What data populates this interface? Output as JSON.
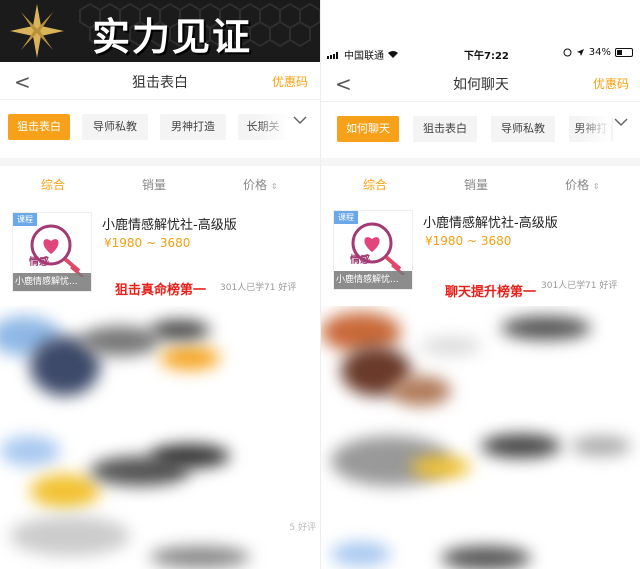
{
  "banner": {
    "title": "实力见证"
  },
  "status": {
    "carrier": "中国联通",
    "time": "下午7:22",
    "battery": "34%"
  },
  "left": {
    "nav": {
      "back": "<",
      "title": "狙击表白",
      "coupon": "优惠码"
    },
    "tabs": [
      "狙击表白",
      "导师私教",
      "男神打造",
      "长期关"
    ],
    "sort": {
      "a": "综合",
      "b": "销量",
      "c": "价格"
    },
    "course": {
      "badge": "课程",
      "title": "小鹿情感解忧社-高级版",
      "price": "¥1980 ~ 3680",
      "learned": "301人已学",
      "rating": "71 好评",
      "thumb_label": "情感",
      "thumb_caption": "小鹿情感解忧..."
    },
    "overlay": "狙击真命榜第一",
    "tail": "5 好评"
  },
  "right": {
    "nav": {
      "back": "<",
      "title": "如何聊天",
      "coupon": "优惠码"
    },
    "tabs": [
      "如何聊天",
      "狙击表白",
      "导师私教",
      "男神打"
    ],
    "sort": {
      "a": "综合",
      "b": "销量",
      "c": "价格"
    },
    "course": {
      "badge": "课程",
      "title": "小鹿情感解忧社-高级版",
      "price": "¥1980 ~ 3680",
      "learned": "301人已学",
      "rating": "71 好评",
      "thumb_label": "情感",
      "thumb_caption": "小鹿情感解忧..."
    },
    "overlay": "聊天提升榜第一"
  },
  "colors": {
    "accent": "#f7a01a",
    "overlay_red": "#e8201a"
  }
}
